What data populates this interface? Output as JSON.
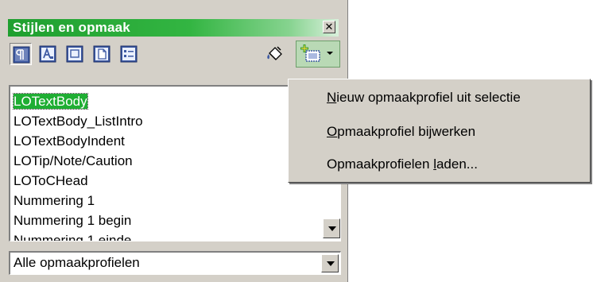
{
  "window": {
    "title": "Stijlen en opmaak",
    "close_label": "✕"
  },
  "toolbar": {
    "buttons": [
      {
        "name": "paragraph-styles",
        "icon": "paragraph-styles-icon",
        "active": true
      },
      {
        "name": "character-styles",
        "icon": "character-styles-icon",
        "active": false
      },
      {
        "name": "frame-styles",
        "icon": "frame-styles-icon",
        "active": false
      },
      {
        "name": "page-styles",
        "icon": "page-styles-icon",
        "active": false
      },
      {
        "name": "list-styles",
        "icon": "list-styles-icon",
        "active": false
      }
    ],
    "fill_format": {
      "icon": "paint-bucket-icon"
    },
    "new_style": {
      "icon": "new-style-from-selection-icon",
      "dropdown": "chevron-down-icon"
    }
  },
  "style_list": {
    "items": [
      "LOTextBody",
      "LOTextBody_ListIntro",
      "LOTextBodyIndent",
      "LOTip/Note/Caution",
      "LOToCHead",
      "Nummering 1",
      "Nummering 1 begin",
      "Nummering 1 einde"
    ],
    "selected_index": 0
  },
  "filter": {
    "value": "Alle opmaakprofielen"
  },
  "menu": {
    "items": [
      {
        "pre": "",
        "accel": "N",
        "post": "ieuw opmaakprofiel uit selectie"
      },
      {
        "pre": "",
        "accel": "O",
        "post": "pmaakprofiel bijwerken"
      },
      {
        "pre": "Opmaakprofielen ",
        "accel": "l",
        "post": "aden..."
      }
    ]
  },
  "colors": {
    "title_bar": "#1f9f2f",
    "selection": "#1fae33",
    "panel_bg": "#d4d0c8"
  }
}
